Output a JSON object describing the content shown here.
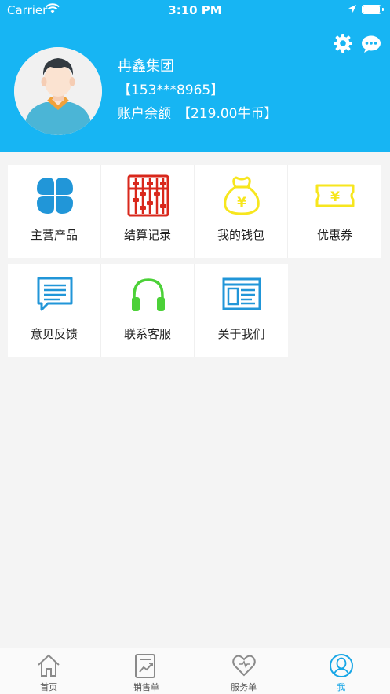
{
  "status_bar": {
    "carrier": "Carrier",
    "time": "3:10 PM"
  },
  "profile": {
    "name": "冉鑫集团",
    "phone": "【153***8965】",
    "balance_label": "账户余额",
    "balance_value": "【219.00牛币】"
  },
  "menu": [
    {
      "label": "主营产品",
      "icon": "clover-grid-icon"
    },
    {
      "label": "结算记录",
      "icon": "abacus-icon"
    },
    {
      "label": "我的钱包",
      "icon": "money-bag-icon"
    },
    {
      "label": "优惠券",
      "icon": "coupon-ticket-icon"
    },
    {
      "label": "意见反馈",
      "icon": "feedback-message-icon"
    },
    {
      "label": "联系客服",
      "icon": "headphones-icon"
    },
    {
      "label": "关于我们",
      "icon": "browser-window-icon"
    }
  ],
  "tabs": [
    {
      "label": "首页",
      "icon": "home-icon"
    },
    {
      "label": "销售单",
      "icon": "sales-chart-icon"
    },
    {
      "label": "服务单",
      "icon": "heart-icon"
    },
    {
      "label": "我",
      "icon": "user-profile-icon",
      "active": true
    }
  ],
  "colors": {
    "header": "#17b5f3",
    "active_tab": "#17a6e6",
    "blue_icon": "#2196d8",
    "red_icon": "#d9281c",
    "yellow_icon": "#f7e61e",
    "green_icon": "#4cd138"
  }
}
